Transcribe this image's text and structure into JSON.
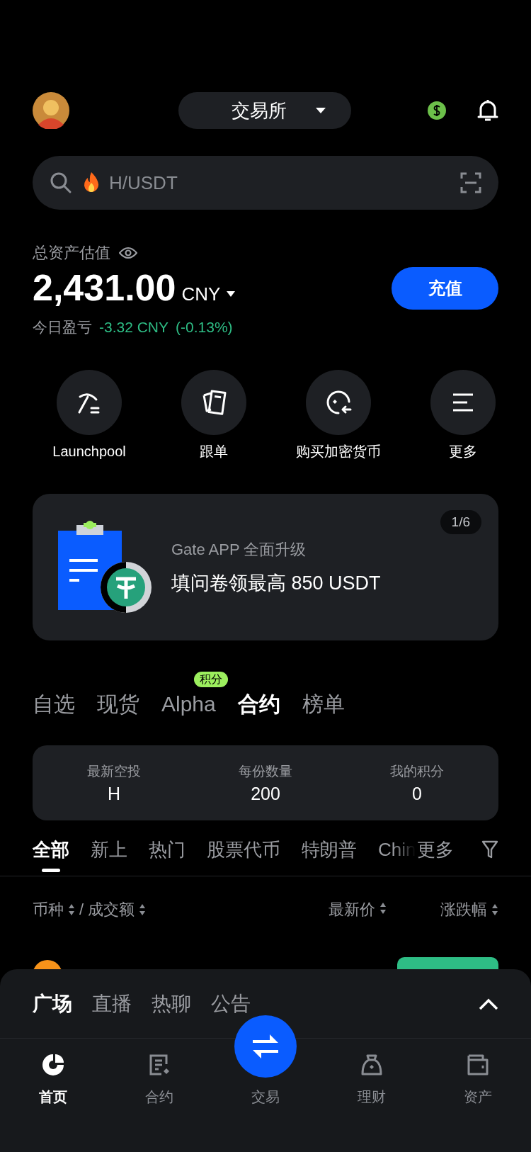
{
  "header": {
    "exchange": "交易所"
  },
  "search": {
    "placeholder": "H/USDT"
  },
  "assets": {
    "label": "总资产估值",
    "amount": "2,431.00",
    "currency": "CNY",
    "pnl_label": "今日盈亏",
    "pnl": "-3.32 CNY",
    "pnl_pct": "(-0.13%)",
    "deposit": "充值"
  },
  "shortcuts": [
    {
      "label": "Launchpool",
      "kind": "pickaxe"
    },
    {
      "label": "跟单",
      "kind": "cards"
    },
    {
      "label": "购买加密货币",
      "kind": "buy"
    },
    {
      "label": "更多",
      "kind": "more"
    }
  ],
  "banner": {
    "counter": "1/6",
    "subtitle": "Gate APP 全面升级",
    "title": "填问卷领最高 850 USDT"
  },
  "market_tabs": [
    {
      "label": "自选",
      "selected": false
    },
    {
      "label": "现货",
      "selected": false
    },
    {
      "label": "Alpha",
      "selected": false,
      "badge": "积分"
    },
    {
      "label": "合约",
      "selected": true
    },
    {
      "label": "榜单",
      "selected": false
    }
  ],
  "airdrop_stats": [
    {
      "label": "最新空投",
      "value": "H"
    },
    {
      "label": "每份数量",
      "value": "200"
    },
    {
      "label": "我的积分",
      "value": "0"
    }
  ],
  "filter_tabs": [
    {
      "label": "全部",
      "selected": true
    },
    {
      "label": "新上",
      "selected": false
    },
    {
      "label": "热门",
      "selected": false
    },
    {
      "label": "股票代币",
      "selected": false
    },
    {
      "label": "特朗普",
      "selected": false
    },
    {
      "label": "Chin",
      "selected": false
    }
  ],
  "filter_more": "更多",
  "table": {
    "header_left": {
      "first": "币种",
      "separator": "/",
      "second": "成交额"
    },
    "columns": [
      "最新价",
      "涨跌幅"
    ],
    "rows": [
      {
        "kind": "up"
      }
    ]
  },
  "sheet": {
    "tabs": [
      {
        "label": "广场",
        "selected": true
      },
      {
        "label": "直播",
        "selected": false
      },
      {
        "label": "热聊",
        "selected": false
      },
      {
        "label": "公告",
        "selected": false
      }
    ]
  },
  "nav": [
    {
      "label": "首页",
      "kind": "home",
      "selected": true
    },
    {
      "label": "合约",
      "kind": "contract",
      "selected": false
    },
    {
      "label": "交易",
      "kind": "trade",
      "selected": false
    },
    {
      "label": "理财",
      "kind": "finance",
      "selected": false
    },
    {
      "label": "资产",
      "kind": "wallet",
      "selected": false
    }
  ]
}
